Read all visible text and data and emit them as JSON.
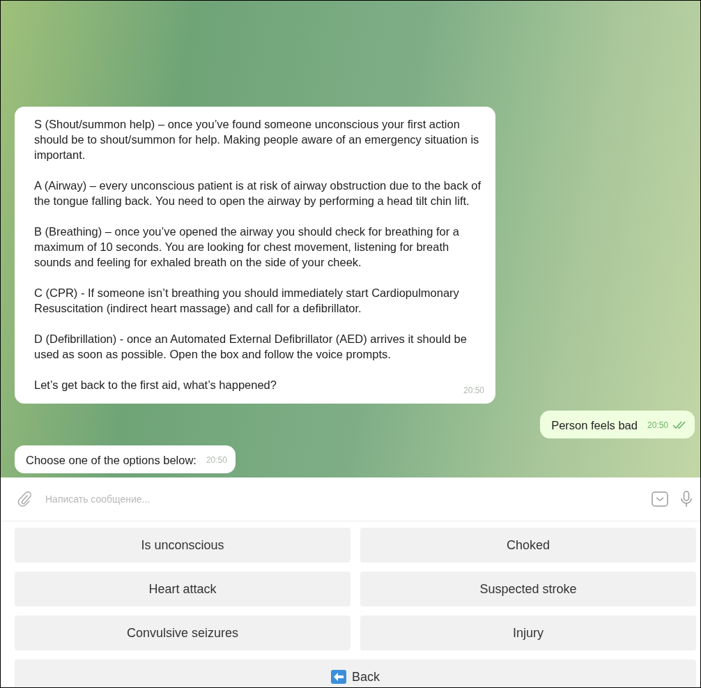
{
  "messages": [
    {
      "kind": "incoming",
      "paragraphs": [
        "S (Shout/summon help) – once you’ve found someone unconscious your first action should be to shout/summon for help. Making people aware of an emergency situation is important.",
        "A (Airway) – every unconscious patient is at risk of airway obstruction due to the back of the tongue falling back.  You need to open the airway by performing a head tilt chin lift.",
        "B (Breathing) – once you’ve opened the airway you should check for breathing for a maximum of 10 seconds. You are looking for chest movement, listening  for breath sounds and feeling for exhaled breath on the side of your cheek.",
        "C (CPR) - If someone isn’t breathing you should immediately start Cardiopulmonary Resuscitation (indirect heart massage) and call for a defibrillator.",
        "D (Defibrillation) - once an Automated External Defibrillator (AED) arrives it should be used as soon as possible. Open the box and follow the voice prompts.",
        "Let’s get back to the first aid, what’s happened?"
      ],
      "time": "20:50"
    },
    {
      "kind": "outgoing",
      "paragraphs": [
        "Person feels bad"
      ],
      "time": "20:50",
      "read": true
    },
    {
      "kind": "incoming",
      "paragraphs": [
        "Choose one of the options below:"
      ],
      "time": "20:50"
    }
  ],
  "composer": {
    "placeholder": "Написать сообщение..."
  },
  "keyboard": [
    [
      {
        "label": "Is unconscious"
      },
      {
        "label": "Choked"
      }
    ],
    [
      {
        "label": "Heart attack"
      },
      {
        "label": "Suspected stroke"
      }
    ],
    [
      {
        "label": "Convulsive seizures"
      },
      {
        "label": "Injury"
      }
    ],
    [
      {
        "label": "Back",
        "kind": "back"
      }
    ]
  ]
}
